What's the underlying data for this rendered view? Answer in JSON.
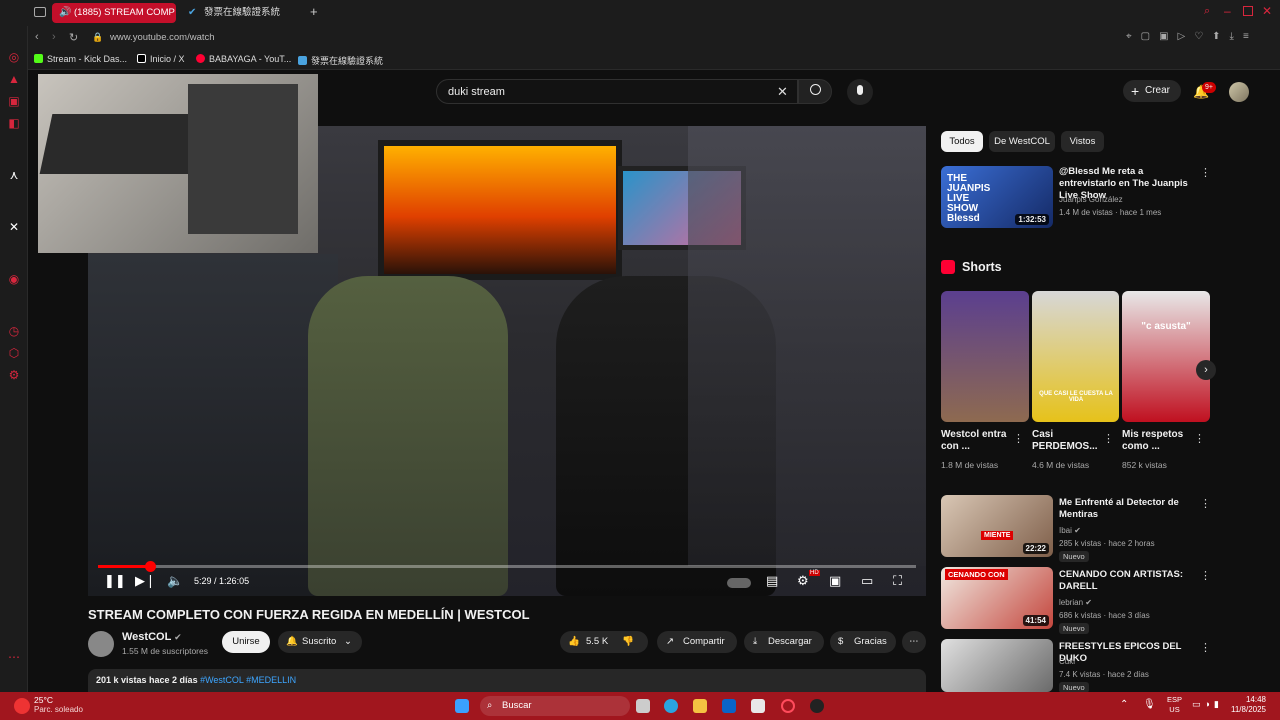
{
  "browser": {
    "tabs": [
      {
        "label": "(1885) STREAM COMP"
      },
      {
        "label": "發票在線驗證系統"
      }
    ],
    "url": "www.youtube.com/watch",
    "bookmarks": [
      {
        "label": "Stream - Kick Das..."
      },
      {
        "label": "Inicio / X"
      },
      {
        "label": "BABAYAGA - YouT..."
      },
      {
        "label": "發票在線驗證系統"
      }
    ]
  },
  "header": {
    "search_value": "duki stream",
    "create_label": "Crear",
    "notif_badge": "9+"
  },
  "player": {
    "current_time": "5:29",
    "duration": "1:26:05",
    "progress_fraction": 0.064,
    "hd_badge": "HD"
  },
  "video": {
    "title": "STREAM COMPLETO CON FUERZA REGIDA EN MEDELLÍN | WESTCOL",
    "channel": "WestCOL",
    "subscribers": "1.55 M de suscriptores",
    "join_label": "Unirse",
    "subscribed_label": "Suscrito",
    "likes": "5.5 K",
    "share_label": "Compartir",
    "download_label": "Descargar",
    "thanks_label": "Gracias",
    "views_date": "201 k vistas  hace 2 días",
    "hashtags": "#WestCOL #MEDELLIN"
  },
  "sidebar": {
    "chips": [
      "Todos",
      "De WestCOL",
      "Vistos"
    ],
    "top_video": {
      "title": "@Blessd Me reta a entrevistarlo en The Juanpis Live Show",
      "channel": "Juanpis González",
      "stats": "1.4 M de vistas · hace 1 mes",
      "duration": "1:32:53",
      "thumb_text": "THE JUANPIS LIVE SHOW Blessd"
    },
    "shorts_title": "Shorts",
    "shorts": [
      {
        "title": "Westcol entra con ...",
        "views": "1.8 M de vistas"
      },
      {
        "title": "Casi PERDEMOS...",
        "views": "4.6 M de vistas",
        "thumb_text": "QUE CASI LE CUESTA LA VIDA"
      },
      {
        "title": "Mis respetos como ...",
        "views": "852 k vistas",
        "thumb_text": "\"c asusta\""
      }
    ],
    "videos": [
      {
        "title": "Me Enfrenté al Detector de Mentiras",
        "channel": "Ibai",
        "stats": "285 k vistas · hace 2 horas",
        "badge": "Nuevo",
        "duration": "22:22",
        "thumb_text": "MIENTE"
      },
      {
        "title": "CENANDO CON ARTISTAS: DARELL",
        "channel": "lebrian",
        "stats": "686 k vistas · hace 3 días",
        "badge": "Nuevo",
        "duration": "41:54",
        "thumb_text": "CENANDO CON"
      },
      {
        "title": "FREESTYLES EPICOS DEL DUKO",
        "channel": "Cuki",
        "stats": "7.4 K vistas · hace 2 días",
        "badge": "Nuevo",
        "duration": ""
      }
    ]
  },
  "taskbar": {
    "weather_temp": "25°C",
    "weather_desc": "Parc. soleado",
    "search_label": "Buscar",
    "lang": "ESP",
    "region": "US",
    "time": "14:48",
    "date": "11/8/2025"
  },
  "colors": {
    "accent": "#ff0000",
    "browser_accent": "#c40f2a",
    "taskbar": "#a1161e"
  }
}
